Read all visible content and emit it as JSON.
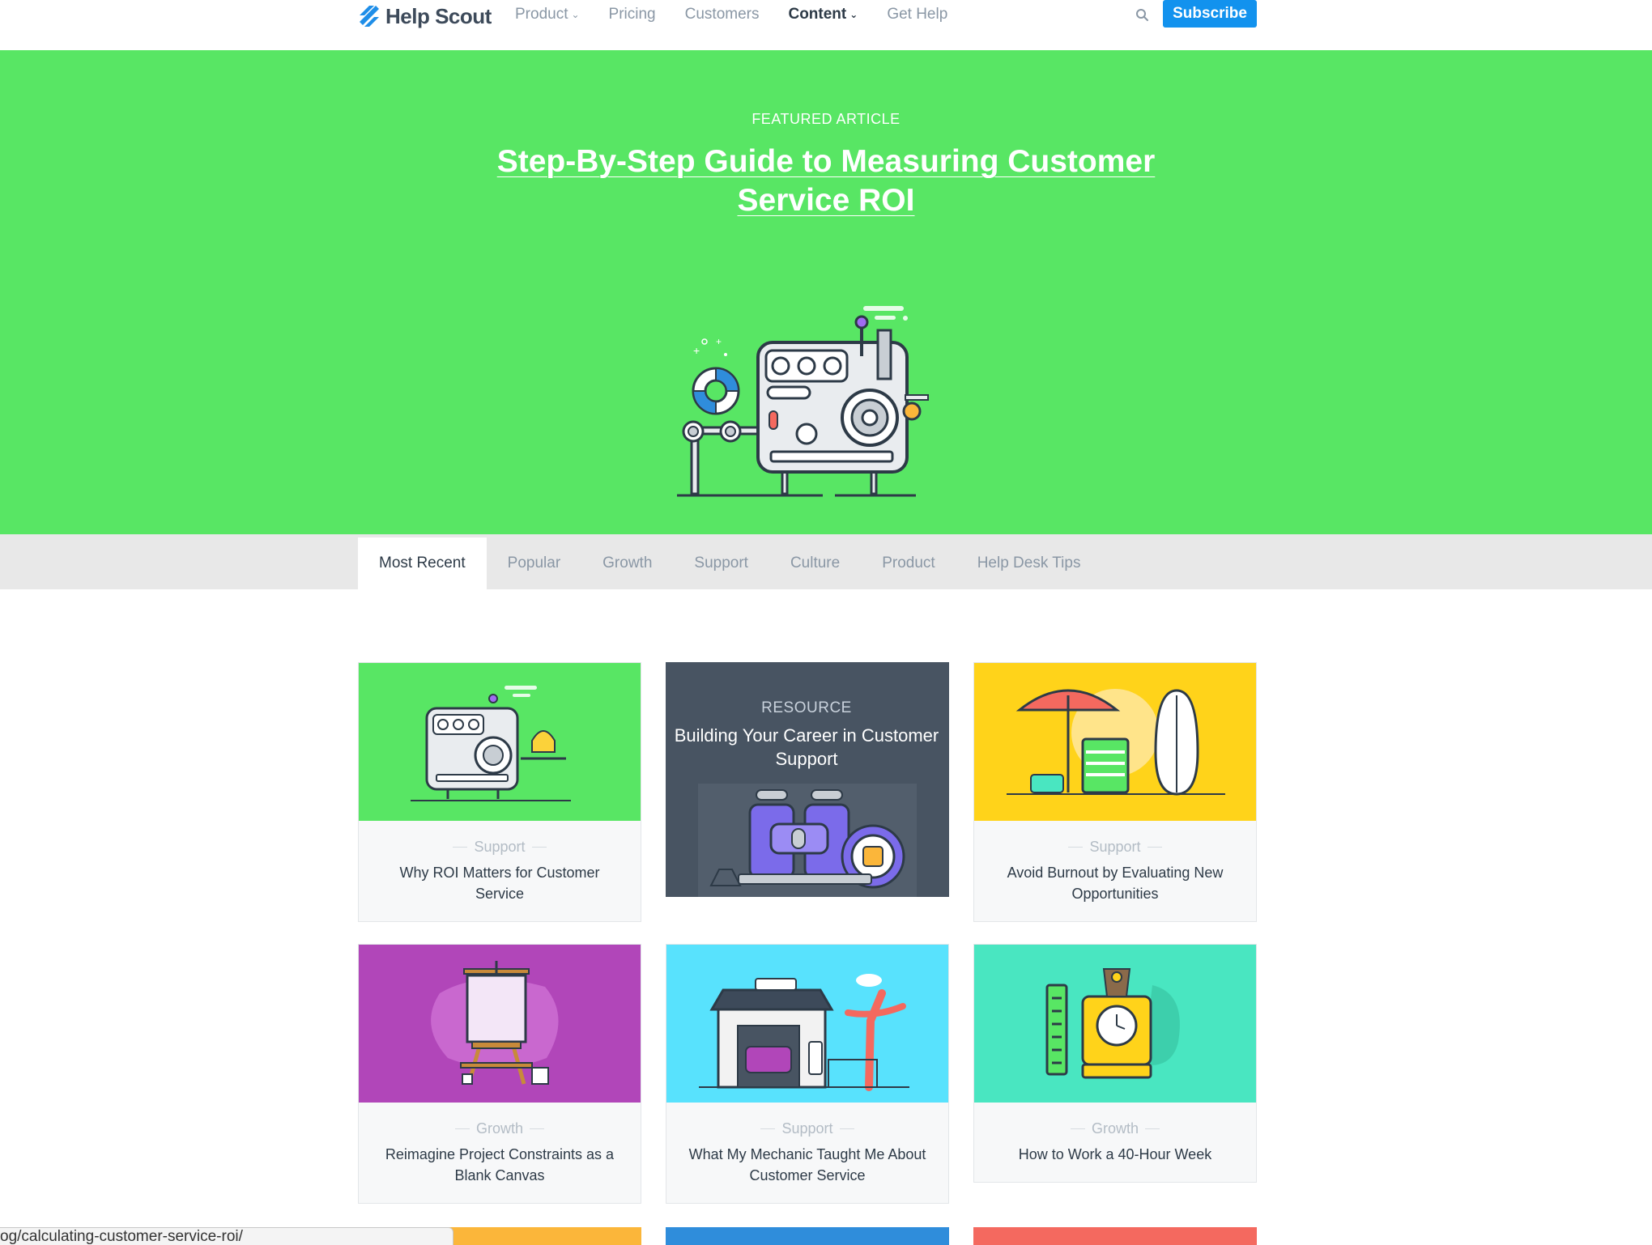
{
  "nav": {
    "logo_text": "Help Scout",
    "links": [
      {
        "label": "Product",
        "dropdown": true
      },
      {
        "label": "Pricing",
        "dropdown": false
      },
      {
        "label": "Customers",
        "dropdown": false
      },
      {
        "label": "Content",
        "dropdown": true,
        "active": true
      },
      {
        "label": "Get Help",
        "dropdown": false
      }
    ],
    "subscribe_label": "Subscribe",
    "icons": {
      "search": "search-icon",
      "chevron": "chevron-down-icon"
    }
  },
  "hero": {
    "kicker": "FEATURED ARTICLE",
    "title": "Step-By-Step Guide to Measuring Customer Service ROI",
    "background": "#58e664"
  },
  "tabs": [
    "Most Recent",
    "Popular",
    "Growth",
    "Support",
    "Culture",
    "Product",
    "Help Desk Tips"
  ],
  "cards": [
    {
      "category": "Support",
      "title": "Why ROI Matters for Customer Service",
      "color": "#58e664"
    },
    {
      "kicker": "RESOURCE",
      "title": "Building Your Career in Customer Support",
      "color": "#485462"
    },
    {
      "category": "Support",
      "title": "Avoid Burnout by Evaluating New Opportunities",
      "color": "#ffd31a"
    },
    {
      "category": "Growth",
      "title": "Reimagine Project Constraints as a Blank Canvas",
      "color": "#b146b9"
    },
    {
      "category": "Support",
      "title": "What My Mechanic Taught Me About Customer Service",
      "color": "#58e2fd"
    },
    {
      "category": "Growth",
      "title": "How to Work a 40-Hour Week",
      "color": "#49e6c1"
    }
  ],
  "peek_colors": [
    "#fbb63a",
    "#2f8ddb",
    "#f4695f"
  ],
  "status_bar_url": "og/calculating-customer-service-roi/"
}
